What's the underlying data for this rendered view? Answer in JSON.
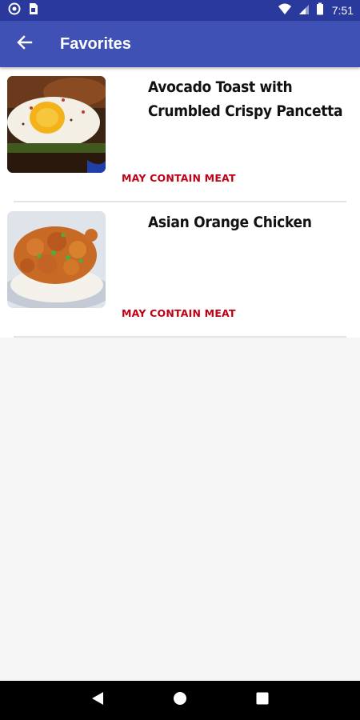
{
  "status_bar": {
    "time": "7:51",
    "left_icons": [
      "notification-circle-icon",
      "sim-card-icon"
    ],
    "right_icons": [
      "wifi-icon",
      "cell-signal-icon",
      "battery-icon"
    ]
  },
  "app_bar": {
    "title": "Favorites",
    "back_icon": "arrow-back-icon",
    "color": "#3f51b5"
  },
  "favorites": [
    {
      "title": "Avocado Toast with Crumbled Crispy Pancetta",
      "tag": "MAY CONTAIN MEAT",
      "image": "avocado-toast-egg-photo"
    },
    {
      "title": "Asian Orange Chicken",
      "tag": "MAY CONTAIN MEAT",
      "image": "orange-chicken-rice-photo"
    }
  ],
  "colors": {
    "status_bar": "#2a3a9c",
    "tag": "#c00015",
    "background": "#f5f5f5"
  },
  "nav_bar": {
    "buttons": [
      "back-triangle-icon",
      "home-circle-icon",
      "recents-square-icon"
    ]
  }
}
